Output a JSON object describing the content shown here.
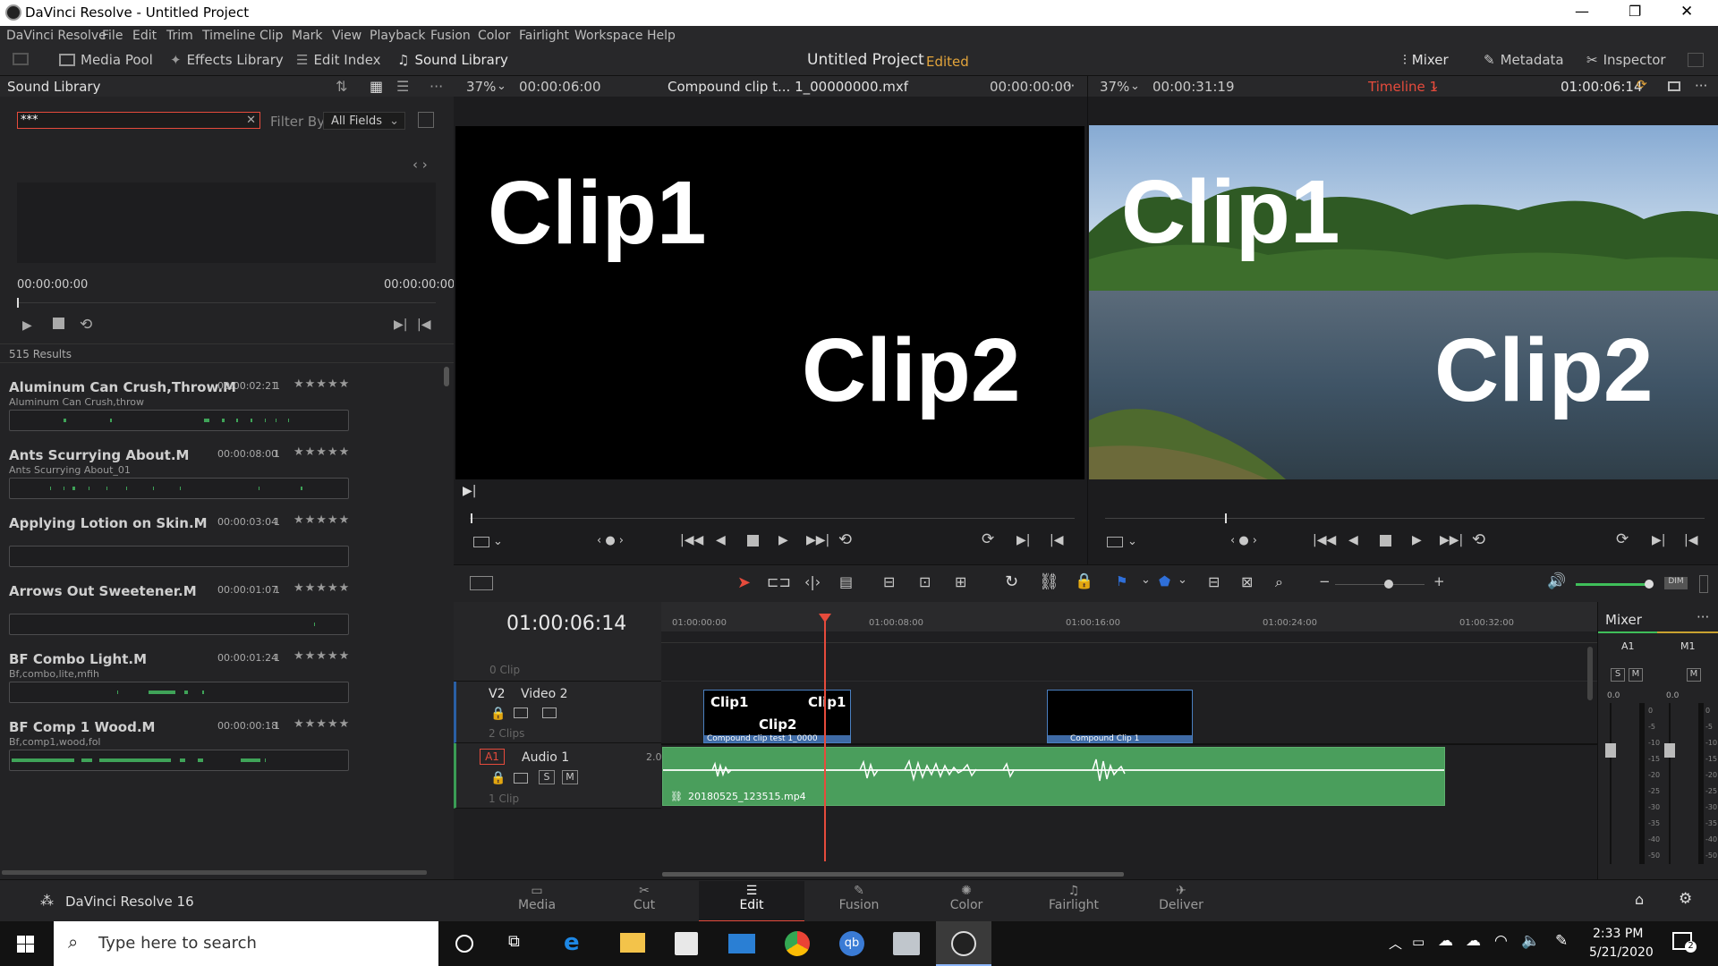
{
  "window": {
    "title": "DaVinci Resolve - Untitled Project",
    "minimize": "—",
    "maximize": "❐",
    "close": "✕"
  },
  "menu": [
    "DaVinci Resolve",
    "File",
    "Edit",
    "Trim",
    "Timeline",
    "Clip",
    "Mark",
    "View",
    "Playback",
    "Fusion",
    "Color",
    "Fairlight",
    "Workspace",
    "Help"
  ],
  "toolbar": {
    "media_pool": "Media Pool",
    "effects_library": "Effects Library",
    "edit_index": "Edit Index",
    "sound_library": "Sound Library",
    "project_title": "Untitled Project",
    "edited": "Edited",
    "mixer": "Mixer",
    "metadata": "Metadata",
    "inspector": "Inspector"
  },
  "sound_library": {
    "title": "Sound Library",
    "search_value": "***",
    "filter_label": "Filter By",
    "filter_value": "All Fields",
    "time_start": "00:00:00:00",
    "time_end": "00:00:00:00",
    "results": "515 Results",
    "items": [
      {
        "name": "Aluminum Can Crush,Throw.M",
        "tags": "Aluminum Can Crush,throw",
        "duration": "00:00:02:21",
        "channels": "1"
      },
      {
        "name": "Ants Scurrying About.M",
        "tags": "Ants Scurrying About_01",
        "duration": "00:00:08:00",
        "channels": "1"
      },
      {
        "name": "Applying Lotion on Skin.M",
        "tags": "",
        "duration": "00:00:03:04",
        "channels": "1"
      },
      {
        "name": "Arrows Out Sweetener.M",
        "tags": "",
        "duration": "00:00:01:07",
        "channels": "1"
      },
      {
        "name": "BF Combo Light.M",
        "tags": "Bf,combo,lite,mfih",
        "duration": "00:00:01:24",
        "channels": "1"
      },
      {
        "name": "BF Comp 1 Wood.M",
        "tags": "Bf,comp1,wood,fol",
        "duration": "00:00:00:18",
        "channels": "1"
      }
    ]
  },
  "source_viewer": {
    "zoom": "37%",
    "timecode": "00:00:06:00",
    "clip_name": "Compound clip t... 1_00000000.mxf",
    "tc_right": "00:00:00:00",
    "text1": "Clip1",
    "text2": "Clip2"
  },
  "timeline_viewer": {
    "zoom": "37%",
    "timecode": "00:00:31:19",
    "timeline_name": "Timeline 1",
    "tc_right": "01:00:06:14",
    "text1": "Clip1",
    "text2": "Clip2"
  },
  "timeline": {
    "current_tc": "01:00:06:14",
    "ruler": [
      "01:00:00:00",
      "01:00:08:00",
      "01:00:16:00",
      "01:00:24:00",
      "01:00:32:00"
    ],
    "v1_clips": "0 Clip",
    "v2": {
      "id": "V2",
      "name": "Video 2",
      "clips": "2 Clips"
    },
    "a1": {
      "id": "A1",
      "name": "Audio 1",
      "level": "2.0",
      "clips": "1 Clip",
      "s": "S",
      "m": "M"
    },
    "clip_a": {
      "t1": "Clip1",
      "t2": "Clip1",
      "t3": "Clip2",
      "label": "Compound clip test 1_0000"
    },
    "clip_b": {
      "label": "Compound Clip 1"
    },
    "audio_clip": "20180525_123515.mp4"
  },
  "mixer": {
    "title": "Mixer",
    "ch1": "A1",
    "ch2": "M1",
    "s": "S",
    "m": "M",
    "val1": "0.0",
    "val2": "0.0",
    "scale": [
      "0",
      "-5",
      "-10",
      "-15",
      "-20",
      "-25",
      "-30",
      "-35",
      "-40",
      "-50"
    ]
  },
  "pages": [
    "Media",
    "Cut",
    "Edit",
    "Fusion",
    "Color",
    "Fairlight",
    "Deliver"
  ],
  "brand": "DaVinci Resolve 16",
  "taskbar": {
    "search_placeholder": "Type here to search",
    "time": "2:33 PM",
    "date": "5/21/2020",
    "notif": "2"
  },
  "colors": {
    "accent": "#e64b3c",
    "audio_green": "#4a9e5c",
    "edited": "#e2a43b"
  }
}
